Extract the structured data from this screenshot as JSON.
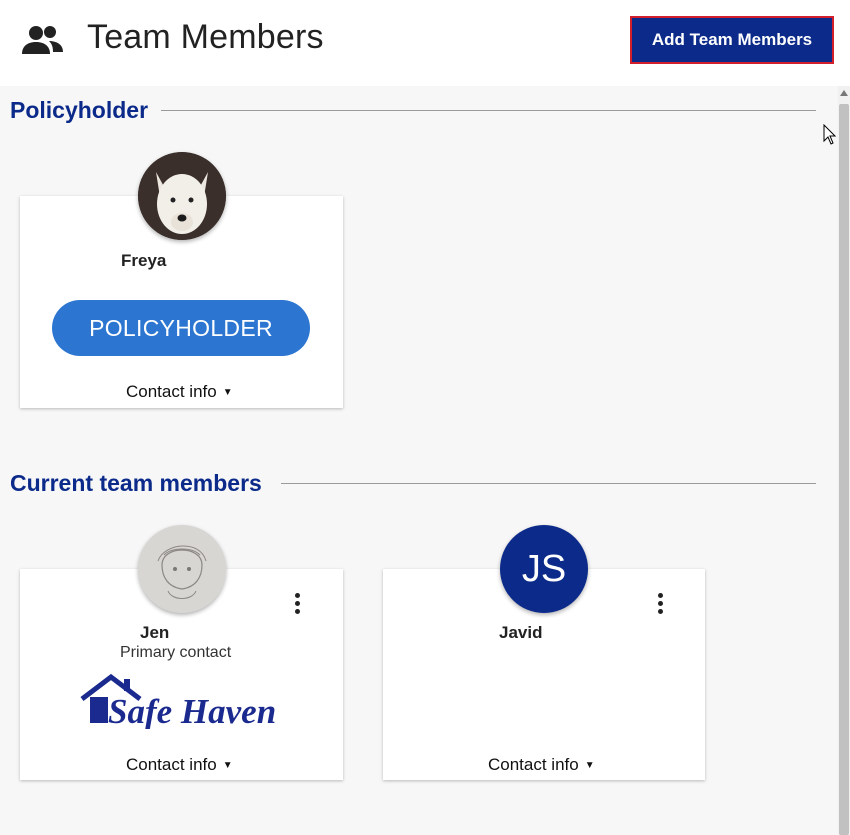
{
  "header": {
    "title": "Team Members",
    "icon": "people-icon",
    "add_button_label": "Add Team Members"
  },
  "sections": {
    "policyholder": {
      "title": "Policyholder",
      "card": {
        "name": "Freya",
        "avatar": "dog-photo-avatar",
        "role_pill": "POLICYHOLDER",
        "contact_label": "Contact info"
      }
    },
    "current": {
      "title": "Current team members",
      "members": [
        {
          "name": "Jen",
          "avatar": "sketch-portrait-avatar",
          "subtitle": "Primary contact",
          "logo_text": "Safe Haven",
          "contact_label": "Contact info"
        },
        {
          "name": "Javid",
          "initials": "JS",
          "avatar": "initials-avatar",
          "contact_label": "Contact info"
        }
      ]
    }
  },
  "colors": {
    "brand_blue": "#0b2a8a",
    "pill_blue": "#2c76d2",
    "button_border": "#d21f2b",
    "page_bg": "#f7f7f7"
  }
}
